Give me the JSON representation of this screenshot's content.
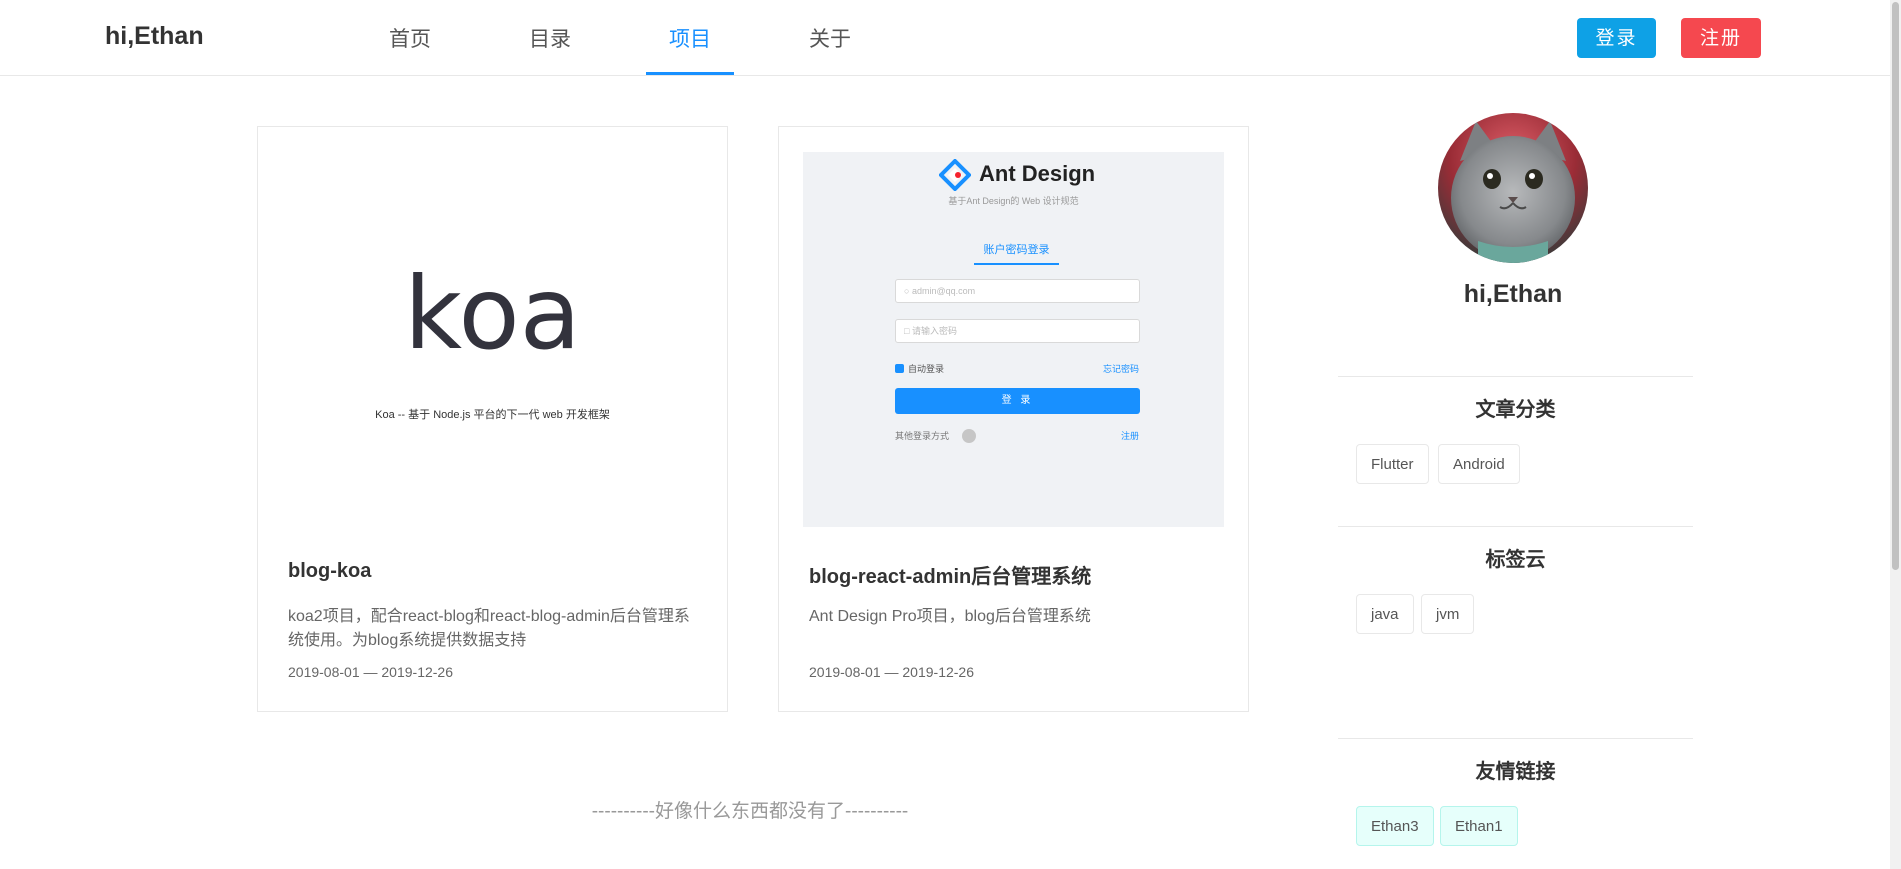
{
  "header": {
    "logo": "hi,Ethan",
    "nav": [
      {
        "label": "首页",
        "active": false
      },
      {
        "label": "目录",
        "active": false
      },
      {
        "label": "项目",
        "active": true
      },
      {
        "label": "关于",
        "active": false
      }
    ],
    "login_label": "登录",
    "register_label": "注册",
    "accent_color": "#1890ff",
    "login_color": "#0ea1e6",
    "register_color": "#f5484f"
  },
  "projects": [
    {
      "title": "blog-koa",
      "desc": "koa2项目，配合react-blog和react-blog-admin后台管理系统使用。为blog系统提供数据支持",
      "date": "2019-08-01 — 2019-12-26",
      "cover": {
        "word": "koa",
        "subtitle": "Koa -- 基于 Node.js 平台的下一代 web 开发框架"
      }
    },
    {
      "title": "blog-react-admin后台管理系统",
      "desc": "Ant Design Pro项目，blog后台管理系统",
      "date": "2019-08-01 — 2019-12-26",
      "cover": {
        "title": "Ant Design",
        "subtitle": "基于Ant Design的 Web 设计规范",
        "tab": "账户密码登录",
        "username_placeholder": "admin@qq.com",
        "password_placeholder": "请输入密码",
        "remember": "自动登录",
        "forgot": "忘记密码",
        "submit": "登 录",
        "other": "其他登录方式",
        "register": "注册"
      }
    }
  ],
  "empty_note": "----------好像什么东西都没有了----------",
  "sidebar": {
    "name": "hi,Ethan",
    "avatar_icon": "cat-avatar",
    "categories": {
      "heading": "文章分类",
      "items": [
        "Flutter",
        "Android"
      ]
    },
    "tags": {
      "heading": "标签云",
      "items": [
        "java",
        "jvm"
      ]
    },
    "links": {
      "heading": "友情链接",
      "items": [
        "Ethan3",
        "Ethan1"
      ]
    }
  }
}
